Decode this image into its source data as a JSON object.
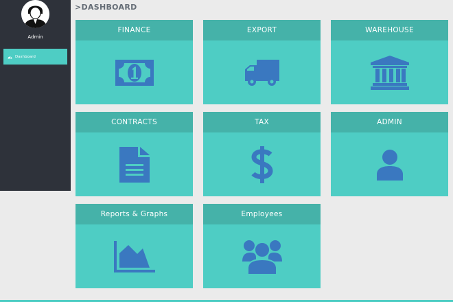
{
  "sidebar": {
    "username": "Admin",
    "items": [
      {
        "label": "Dashboard",
        "icon": "dashboard-icon",
        "active": true
      }
    ]
  },
  "header": {
    "breadcrumb": ">DASHBOARD"
  },
  "cards": [
    {
      "label": "FINANCE",
      "icon": "banknote-icon"
    },
    {
      "label": "EXPORT",
      "icon": "truck-icon"
    },
    {
      "label": "WAREHOUSE",
      "icon": "institution-icon"
    },
    {
      "label": "CONTRACTS",
      "icon": "document-icon"
    },
    {
      "label": "TAX",
      "icon": "dollar-icon"
    },
    {
      "label": "ADMIN",
      "icon": "user-icon"
    },
    {
      "label": "Reports & Graphs",
      "icon": "area-chart-icon"
    },
    {
      "label": "Employees",
      "icon": "users-icon"
    }
  ],
  "colors": {
    "sidebar": "#2e323a",
    "accent": "#4ecdc4",
    "card_header": "#45b2a9",
    "icon": "#3a78c0",
    "background": "#ebebeb"
  }
}
